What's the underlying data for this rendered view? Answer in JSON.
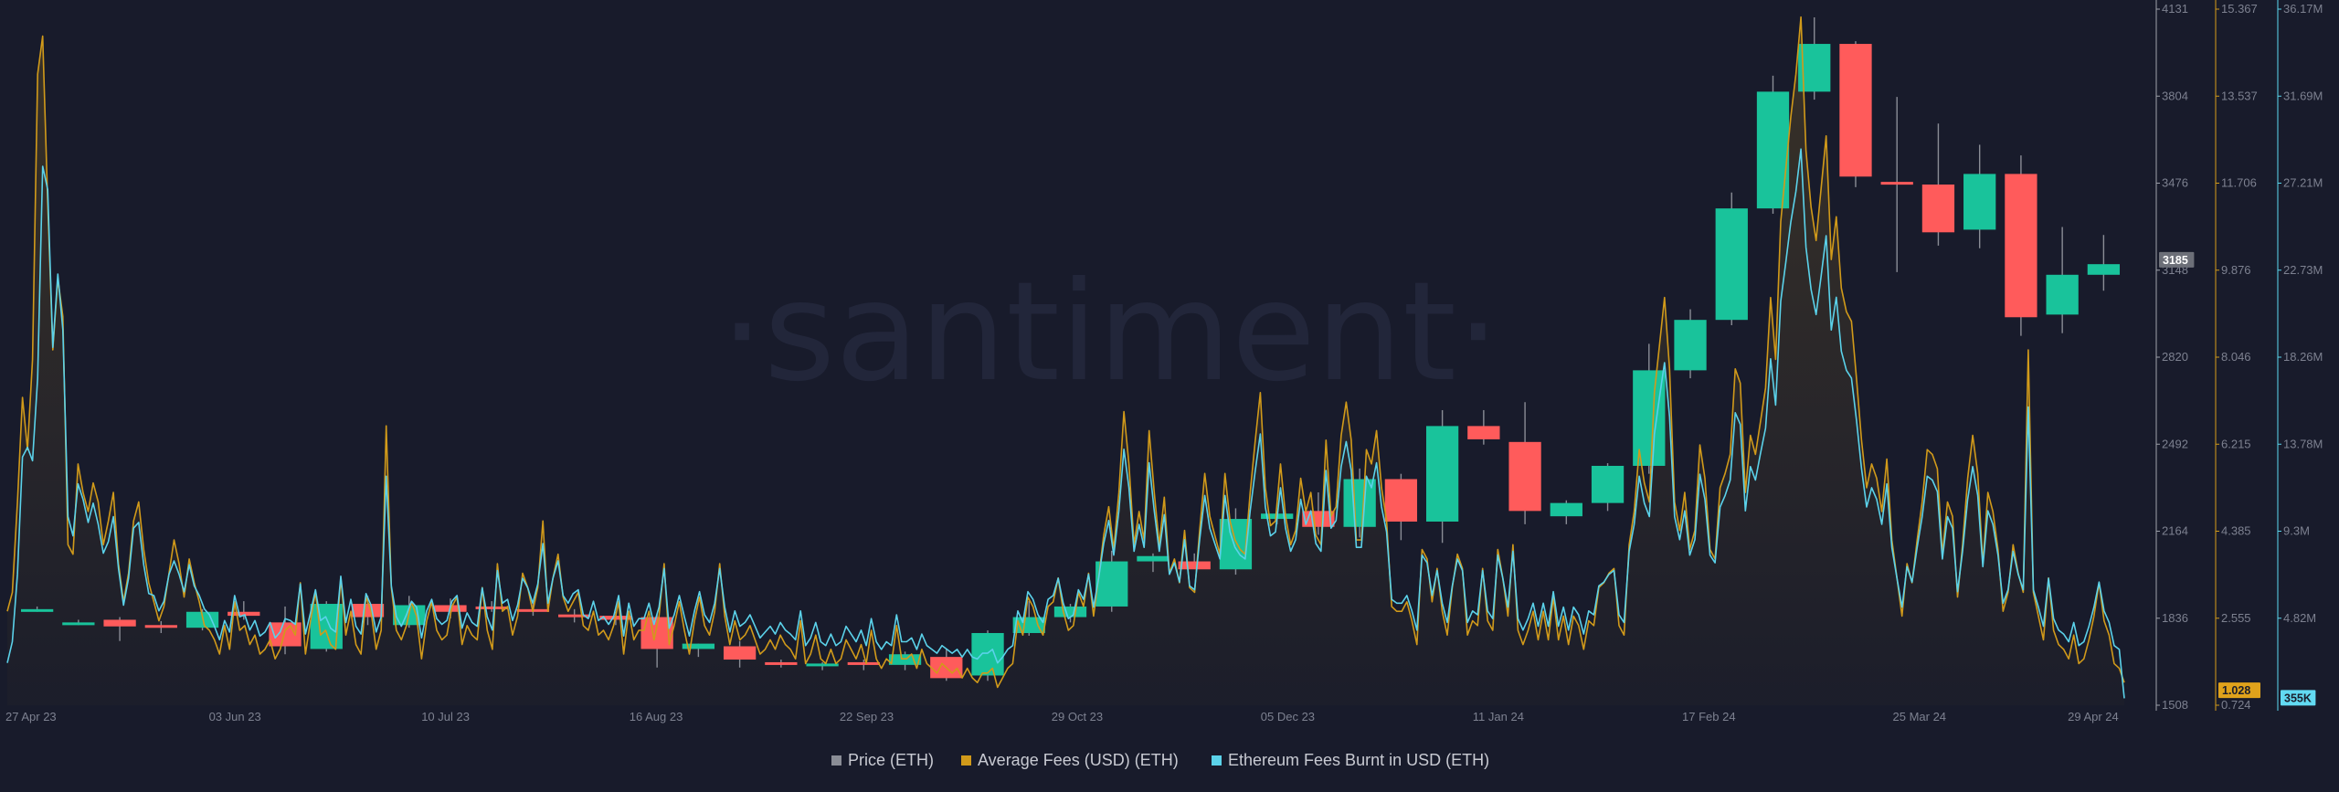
{
  "watermark": "·santiment·",
  "chart_data": {
    "type": "candlestick+line",
    "x_tick_labels": [
      "27 Apr 23",
      "03 Jun 23",
      "10 Jul 23",
      "16 Aug 23",
      "22 Sep 23",
      "29 Oct 23",
      "05 Dec 23",
      "11 Jan 24",
      "17 Feb 24",
      "25 Mar 24",
      "29 Apr 24"
    ],
    "x_tick_dates": [
      "2023-04-27",
      "2023-06-03",
      "2023-07-10",
      "2023-08-16",
      "2023-09-22",
      "2023-10-29",
      "2023-12-05",
      "2024-01-11",
      "2024-02-17",
      "2024-03-25",
      "2024-04-29"
    ],
    "axes": {
      "price": {
        "min": 1508,
        "max": 4131,
        "ticks": [
          "4131",
          "3804",
          "3476",
          "3148",
          "2820",
          "2492",
          "2164",
          "1836",
          "1508"
        ],
        "current": "3185",
        "color": "#9c9fa8"
      },
      "fees": {
        "min": 0.724,
        "max": 15.367,
        "ticks": [
          "15.367",
          "13.537",
          "11.706",
          "9.876",
          "8.046",
          "6.215",
          "4.385",
          "2.555",
          "0.724"
        ],
        "current": "1.028",
        "color": "#d19a1a"
      },
      "burnt": {
        "min": 0,
        "max": 36.17,
        "unit": "M",
        "ticks": [
          "36.17M",
          "31.69M",
          "27.21M",
          "22.73M",
          "18.26M",
          "13.78M",
          "9.3M",
          "4.82M"
        ],
        "current": "355K",
        "color": "#5bd2ea"
      }
    },
    "legend": [
      {
        "label": "Price (ETH)",
        "color": "#8a8d96"
      },
      {
        "label": "Average Fees (USD) (ETH)",
        "color": "#d19a1a"
      },
      {
        "label": "Ethereum Fees Burnt in USD (ETH)",
        "color": "#5bd2ea"
      }
    ],
    "candles": [
      {
        "o": 1870,
        "h": 1880,
        "l": 1860,
        "c": 1870
      },
      {
        "o": 1820,
        "h": 1830,
        "l": 1810,
        "c": 1820
      },
      {
        "o": 1830,
        "h": 1840,
        "l": 1750,
        "c": 1805
      },
      {
        "o": 1810,
        "h": 1825,
        "l": 1780,
        "c": 1800
      },
      {
        "o": 1800,
        "h": 1870,
        "l": 1790,
        "c": 1860
      },
      {
        "o": 1860,
        "h": 1900,
        "l": 1830,
        "c": 1845
      },
      {
        "o": 1820,
        "h": 1880,
        "l": 1700,
        "c": 1730
      },
      {
        "o": 1720,
        "h": 1900,
        "l": 1710,
        "c": 1890
      },
      {
        "o": 1890,
        "h": 1920,
        "l": 1810,
        "c": 1840
      },
      {
        "o": 1810,
        "h": 1920,
        "l": 1800,
        "c": 1885
      },
      {
        "o": 1885,
        "h": 1910,
        "l": 1835,
        "c": 1860
      },
      {
        "o": 1880,
        "h": 1900,
        "l": 1860,
        "c": 1875
      },
      {
        "o": 1870,
        "h": 1900,
        "l": 1845,
        "c": 1860
      },
      {
        "o": 1850,
        "h": 1870,
        "l": 1820,
        "c": 1845
      },
      {
        "o": 1845,
        "h": 1860,
        "l": 1810,
        "c": 1830
      },
      {
        "o": 1840,
        "h": 1850,
        "l": 1650,
        "c": 1720
      },
      {
        "o": 1720,
        "h": 1740,
        "l": 1690,
        "c": 1740
      },
      {
        "o": 1730,
        "h": 1750,
        "l": 1650,
        "c": 1680
      },
      {
        "o": 1670,
        "h": 1680,
        "l": 1650,
        "c": 1660
      },
      {
        "o": 1660,
        "h": 1670,
        "l": 1640,
        "c": 1665
      },
      {
        "o": 1670,
        "h": 1680,
        "l": 1640,
        "c": 1660
      },
      {
        "o": 1660,
        "h": 1710,
        "l": 1640,
        "c": 1700
      },
      {
        "o": 1690,
        "h": 1720,
        "l": 1600,
        "c": 1610
      },
      {
        "o": 1620,
        "h": 1790,
        "l": 1600,
        "c": 1780
      },
      {
        "o": 1780,
        "h": 1900,
        "l": 1770,
        "c": 1840
      },
      {
        "o": 1840,
        "h": 1890,
        "l": 1820,
        "c": 1880
      },
      {
        "o": 1880,
        "h": 2090,
        "l": 1860,
        "c": 2050
      },
      {
        "o": 2050,
        "h": 2080,
        "l": 2010,
        "c": 2070
      },
      {
        "o": 2050,
        "h": 2080,
        "l": 2030,
        "c": 2020
      },
      {
        "o": 2020,
        "h": 2250,
        "l": 2000,
        "c": 2210
      },
      {
        "o": 2210,
        "h": 2240,
        "l": 2190,
        "c": 2230
      },
      {
        "o": 2240,
        "h": 2310,
        "l": 2150,
        "c": 2180
      },
      {
        "o": 2180,
        "h": 2400,
        "l": 2140,
        "c": 2360
      },
      {
        "o": 2360,
        "h": 2380,
        "l": 2130,
        "c": 2200
      },
      {
        "o": 2200,
        "h": 2620,
        "l": 2120,
        "c": 2560
      },
      {
        "o": 2560,
        "h": 2620,
        "l": 2490,
        "c": 2510
      },
      {
        "o": 2500,
        "h": 2650,
        "l": 2190,
        "c": 2240
      },
      {
        "o": 2220,
        "h": 2280,
        "l": 2190,
        "c": 2270
      },
      {
        "o": 2270,
        "h": 2420,
        "l": 2240,
        "c": 2410
      },
      {
        "o": 2410,
        "h": 2870,
        "l": 2380,
        "c": 2770
      },
      {
        "o": 2770,
        "h": 3000,
        "l": 2740,
        "c": 2960
      },
      {
        "o": 2960,
        "h": 3440,
        "l": 2940,
        "c": 3380
      },
      {
        "o": 3380,
        "h": 3880,
        "l": 3360,
        "c": 3820
      },
      {
        "o": 3820,
        "h": 4100,
        "l": 3790,
        "c": 4000
      },
      {
        "o": 4000,
        "h": 4010,
        "l": 3460,
        "c": 3500
      },
      {
        "o": 3480,
        "h": 3800,
        "l": 3140,
        "c": 3470
      },
      {
        "o": 3470,
        "h": 3700,
        "l": 3240,
        "c": 3290
      },
      {
        "o": 3300,
        "h": 3620,
        "l": 3230,
        "c": 3510
      },
      {
        "o": 3510,
        "h": 3580,
        "l": 2900,
        "c": 2970
      },
      {
        "o": 2980,
        "h": 3310,
        "l": 2910,
        "c": 3130
      },
      {
        "o": 3130,
        "h": 3280,
        "l": 3070,
        "c": 3170
      }
    ],
    "fees_usd": [
      2.7,
      3.1,
      5.0,
      7.2,
      6.1,
      8.0,
      14.0,
      14.8,
      11.3,
      8.2,
      9.7,
      8.9,
      4.1,
      3.9,
      5.8,
      5.2,
      4.8,
      5.4,
      5.0,
      4.1,
      4.6,
      5.2,
      3.7,
      2.9,
      3.5,
      4.6,
      5.0,
      4.0,
      3.3,
      2.9,
      2.5,
      2.8,
      3.5,
      4.2,
      3.7,
      3.0,
      3.8,
      3.3,
      2.9,
      2.4,
      2.3,
      2.1,
      1.8,
      2.4,
      1.9,
      2.9,
      2.3,
      2.4,
      2.0,
      2.2,
      1.8,
      1.9,
      2.1,
      1.7,
      1.9,
      2.3,
      2.4,
      2.2,
      3.3,
      1.8,
      2.5,
      3.1,
      2.2,
      2.3,
      2.0,
      1.9,
      3.4,
      2.2,
      2.7,
      2.0,
      1.8,
      3.0,
      2.7,
      1.9,
      2.3,
      6.6,
      3.2,
      2.3,
      2.1,
      2.4,
      2.9,
      2.6,
      1.7,
      2.5,
      2.9,
      2.3,
      2.1,
      2.2,
      2.8,
      3.0,
      2.0,
      2.4,
      2.2,
      2.1,
      3.2,
      2.3,
      1.9,
      3.7,
      2.7,
      2.8,
      2.2,
      2.6,
      3.5,
      3.2,
      2.7,
      3.2,
      4.6,
      2.7,
      3.4,
      3.9,
      3.0,
      2.7,
      2.9,
      3.1,
      2.4,
      2.3,
      2.7,
      2.2,
      2.3,
      2.1,
      2.4,
      2.9,
      1.8,
      2.7,
      2.1,
      2.3,
      2.3,
      2.7,
      2.1,
      2.6,
      3.7,
      2.0,
      2.4,
      2.9,
      2.3,
      1.8,
      2.5,
      3.0,
      2.4,
      2.2,
      2.7,
      3.7,
      2.6,
      2.0,
      2.5,
      2.1,
      2.2,
      2.4,
      2.1,
      1.8,
      1.9,
      2.1,
      1.9,
      2.2,
      2.0,
      1.9,
      1.7,
      2.5,
      1.6,
      1.8,
      2.2,
      1.7,
      1.6,
      1.9,
      1.6,
      1.7,
      2.1,
      1.9,
      1.7,
      2.0,
      1.6,
      2.3,
      1.7,
      1.5,
      1.7,
      1.6,
      2.4,
      1.7,
      1.7,
      1.8,
      1.5,
      1.9,
      1.6,
      1.5,
      1.4,
      1.6,
      1.5,
      1.4,
      1.5,
      1.3,
      1.5,
      1.3,
      1.2,
      1.4,
      1.4,
      1.5,
      1.1,
      1.3,
      1.5,
      1.6,
      2.5,
      2.2,
      3.0,
      2.8,
      2.4,
      2.2,
      2.8,
      2.9,
      3.4,
      2.7,
      2.3,
      2.4,
      3.1,
      2.8,
      3.5,
      2.6,
      3.4,
      4.3,
      4.9,
      4.0,
      5.2,
      6.9,
      5.8,
      4.1,
      4.8,
      4.2,
      6.5,
      5.2,
      4.1,
      5.1,
      3.5,
      3.8,
      3.3,
      4.4,
      3.2,
      3.1,
      4.4,
      5.6,
      4.7,
      4.3,
      3.9,
      5.6,
      4.6,
      4.2,
      4.0,
      3.9,
      5.2,
      6.3,
      7.3,
      5.3,
      4.5,
      4.6,
      5.8,
      4.7,
      4.1,
      4.4,
      5.5,
      4.8,
      5.2,
      4.3,
      4.1,
      6.3,
      4.7,
      4.9,
      6.4,
      7.1,
      6.3,
      4.2,
      4.2,
      6.1,
      5.8,
      6.5,
      5.3,
      4.6,
      2.8,
      2.7,
      2.7,
      2.9,
      2.5,
      2.0,
      4.0,
      3.8,
      2.9,
      3.6,
      2.7,
      2.2,
      3.2,
      3.9,
      3.6,
      2.2,
      2.5,
      2.4,
      3.6,
      2.5,
      2.3,
      4.0,
      3.4,
      2.6,
      4.1,
      2.3,
      2.0,
      2.3,
      2.7,
      2.1,
      2.7,
      2.1,
      3.0,
      2.1,
      2.6,
      2.0,
      2.6,
      2.4,
      1.9,
      2.5,
      2.4,
      3.2,
      3.3,
      3.5,
      3.6,
      2.4,
      2.2,
      4.1,
      4.8,
      6.1,
      5.4,
      5.0,
      7.3,
      8.3,
      9.3,
      7.8,
      5.0,
      4.4,
      5.2,
      4.0,
      4.4,
      6.2,
      5.5,
      4.0,
      3.8,
      5.3,
      5.6,
      6.0,
      7.8,
      7.5,
      5.2,
      6.4,
      6.0,
      6.7,
      7.4,
      9.3,
      8.0,
      10.9,
      12.0,
      13.1,
      14.0,
      15.2,
      12.4,
      11.2,
      10.5,
      11.6,
      12.7,
      10.1,
      11.0,
      9.5,
      9.0,
      8.8,
      7.6,
      6.3,
      5.3,
      5.8,
      5.5,
      4.8,
      5.9,
      4.2,
      3.4,
      2.6,
      3.7,
      3.3,
      4.2,
      5.0,
      6.1,
      6.0,
      5.7,
      3.9,
      5.0,
      4.7,
      3.0,
      4.1,
      5.5,
      6.4,
      5.6,
      3.7,
      5.2,
      4.8,
      4.0,
      2.7,
      3.1,
      4.1,
      3.5,
      3.1,
      8.2,
      3.1,
      2.6,
      2.1,
      3.4,
      2.3,
      2.0,
      1.9,
      1.7,
      2.2,
      1.6,
      1.7,
      2.1,
      2.6,
      3.3,
      2.5,
      2.2,
      1.6,
      1.5,
      1.2
    ],
    "burnt_usd_millions": [
      2.2,
      3.3,
      6.8,
      12.9,
      13.4,
      12.7,
      17.0,
      28.0,
      26.8,
      18.6,
      22.4,
      19.5,
      9.8,
      8.8,
      11.5,
      10.7,
      9.5,
      10.5,
      9.4,
      7.9,
      8.5,
      9.8,
      7.1,
      5.2,
      6.6,
      9.2,
      9.5,
      7.3,
      5.8,
      5.7,
      4.9,
      5.4,
      6.8,
      7.5,
      6.8,
      5.9,
      7.3,
      6.2,
      5.7,
      5.0,
      4.7,
      4.1,
      3.4,
      4.4,
      3.8,
      5.7,
      4.6,
      4.7,
      3.9,
      4.4,
      3.6,
      3.8,
      4.3,
      3.5,
      3.8,
      4.5,
      4.4,
      4.2,
      6.3,
      3.7,
      4.8,
      6.0,
      4.4,
      4.6,
      4.0,
      3.8,
      6.7,
      4.3,
      5.5,
      4.1,
      3.7,
      5.8,
      5.2,
      3.8,
      4.6,
      11.9,
      6.2,
      4.6,
      4.1,
      4.7,
      5.4,
      5.1,
      3.5,
      4.9,
      5.5,
      4.5,
      4.2,
      4.4,
      5.4,
      5.7,
      4.0,
      4.8,
      4.3,
      4.1,
      6.1,
      4.6,
      3.9,
      7.0,
      5.3,
      5.5,
      4.4,
      5.2,
      6.6,
      6.1,
      5.3,
      6.3,
      8.4,
      5.3,
      6.6,
      7.5,
      5.7,
      5.3,
      5.8,
      6.0,
      4.7,
      4.5,
      5.4,
      4.4,
      4.6,
      4.2,
      4.6,
      5.7,
      3.6,
      5.3,
      4.1,
      4.5,
      4.5,
      5.3,
      4.2,
      5.1,
      7.1,
      4.0,
      4.7,
      5.7,
      4.6,
      3.6,
      4.9,
      5.9,
      4.7,
      4.3,
      5.3,
      7.1,
      5.1,
      3.8,
      4.9,
      4.1,
      4.3,
      4.7,
      4.1,
      3.5,
      3.8,
      4.1,
      3.7,
      4.3,
      3.9,
      3.7,
      3.4,
      4.9,
      3.1,
      3.5,
      4.3,
      3.3,
      3.1,
      3.7,
      3.1,
      3.3,
      4.1,
      3.7,
      3.3,
      3.9,
      3.1,
      4.5,
      3.3,
      2.9,
      3.3,
      3.1,
      4.7,
      3.3,
      3.3,
      3.5,
      2.9,
      3.7,
      3.1,
      2.9,
      2.7,
      3.1,
      2.9,
      2.7,
      2.9,
      2.5,
      2.9,
      2.5,
      2.4,
      2.7,
      2.7,
      2.9,
      2.2,
      2.5,
      2.9,
      3.1,
      4.9,
      4.3,
      5.9,
      5.5,
      4.7,
      4.3,
      5.5,
      5.7,
      6.6,
      5.3,
      4.5,
      4.7,
      6.0,
      5.5,
      6.8,
      5.1,
      6.6,
      8.4,
      9.6,
      7.8,
      10.1,
      13.3,
      11.3,
      8.0,
      9.4,
      8.2,
      12.6,
      10.1,
      8.0,
      9.9,
      6.8,
      7.4,
      6.4,
      8.6,
      6.2,
      6.0,
      8.6,
      10.9,
      9.2,
      8.4,
      7.6,
      10.9,
      9.0,
      8.2,
      7.8,
      7.6,
      10.1,
      12.2,
      14.1,
      10.3,
      8.8,
      9.0,
      11.3,
      9.2,
      8.0,
      8.6,
      10.7,
      9.4,
      10.1,
      8.4,
      8.0,
      12.2,
      9.2,
      9.6,
      12.4,
      13.7,
      12.2,
      8.2,
      8.2,
      11.9,
      11.3,
      12.6,
      10.3,
      9.0,
      5.5,
      5.3,
      5.3,
      5.7,
      4.9,
      3.9,
      7.8,
      7.4,
      5.7,
      7.0,
      5.3,
      4.3,
      6.2,
      7.6,
      7.0,
      4.3,
      4.9,
      4.7,
      7.0,
      4.9,
      4.5,
      7.8,
      6.6,
      5.1,
      8.0,
      4.5,
      3.9,
      4.5,
      5.3,
      4.1,
      5.3,
      4.1,
      5.9,
      4.1,
      5.1,
      3.9,
      5.1,
      4.7,
      3.7,
      4.9,
      4.7,
      6.2,
      6.4,
      6.8,
      7.0,
      4.7,
      4.3,
      8.0,
      9.4,
      11.9,
      10.5,
      9.8,
      14.1,
      16.0,
      17.8,
      15.0,
      9.8,
      8.6,
      10.1,
      7.8,
      8.6,
      12.0,
      10.7,
      7.8,
      7.4,
      10.3,
      10.9,
      11.7,
      15.2,
      14.6,
      10.1,
      12.4,
      11.7,
      13.1,
      14.4,
      18.0,
      15.6,
      21.0,
      23.0,
      25.1,
      26.7,
      28.9,
      23.8,
      21.6,
      20.3,
      22.3,
      24.4,
      19.5,
      21.2,
      18.4,
      17.4,
      17.0,
      14.8,
      12.3,
      10.3,
      11.3,
      10.7,
      9.4,
      11.5,
      8.2,
      6.6,
      5.1,
      7.2,
      6.4,
      8.2,
      9.8,
      11.9,
      11.7,
      11.1,
      7.6,
      9.8,
      9.2,
      5.9,
      8.0,
      10.7,
      12.4,
      10.9,
      7.2,
      10.1,
      9.4,
      7.8,
      5.3,
      6.0,
      8.0,
      6.8,
      6.0,
      15.5,
      6.0,
      5.1,
      4.1,
      6.6,
      4.5,
      3.9,
      3.7,
      3.3,
      4.3,
      3.1,
      3.3,
      4.1,
      5.1,
      6.4,
      4.9,
      4.3,
      3.1,
      2.9,
      0.36
    ]
  }
}
